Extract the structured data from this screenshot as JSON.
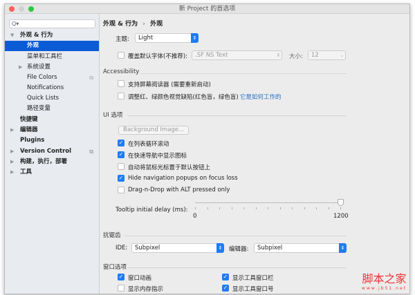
{
  "window": {
    "title": "新 Project 的首选项"
  },
  "sidebar": {
    "search_placeholder": "Q▾",
    "items": [
      {
        "label": "外观 & 行为"
      },
      {
        "label": "外观"
      },
      {
        "label": "菜单和工具栏"
      },
      {
        "label": "系统设置"
      },
      {
        "label": "File Colors"
      },
      {
        "label": "Notifications"
      },
      {
        "label": "Quick Lists"
      },
      {
        "label": "路径变量"
      },
      {
        "label": "快捷键"
      },
      {
        "label": "编辑器"
      },
      {
        "label": "Plugins"
      },
      {
        "label": "Version Control"
      },
      {
        "label": "构建，执行，部署"
      },
      {
        "label": "工具"
      }
    ]
  },
  "breadcrumb": {
    "parent": "外观 & 行为",
    "sep": "›",
    "current": "外观"
  },
  "theme": {
    "label": "主题:",
    "value": "Light"
  },
  "font": {
    "label": "覆盖默认字体(不推荐):",
    "value": ".SF NS Text",
    "size_label": "大小:",
    "size_value": "12",
    "checked": false
  },
  "accessibility": {
    "title": "Accessibility",
    "screen_reader": "支持屏幕阅读器 (需要重新启动)",
    "color_blind": "调整红、绿颜色视觉缺陷(红色盲，绿色盲)",
    "how_link": "它是如何工作的"
  },
  "ui_options": {
    "title": "UI 选项",
    "background_button": "Background Image...",
    "checks": [
      {
        "label": "在列表循环滚动",
        "checked": true
      },
      {
        "label": "在快速导航中显示图标",
        "checked": true
      },
      {
        "label": "自动将鼠标光标置于默认按钮上",
        "checked": false
      },
      {
        "label": "Hide navigation popups on focus loss",
        "checked": true
      },
      {
        "label": "Drag-n-Drop with ALT pressed only",
        "checked": false
      }
    ],
    "tooltip_label": "Tooltip initial delay (ms):",
    "slider_min": "0",
    "slider_max": "1200",
    "slider_value": 1200
  },
  "antialias": {
    "title": "抗锯齿",
    "ide_label": "IDE:",
    "ide_value": "Subpixel",
    "editor_label": "编辑器:",
    "editor_value": "Subpixel"
  },
  "window_options": {
    "title": "窗口选项",
    "checks": [
      {
        "label": "窗口动画",
        "checked": true
      },
      {
        "label": "显示工具窗口栏",
        "checked": true
      },
      {
        "label": "显示内存指示",
        "checked": false
      },
      {
        "label": "显示工具窗口号",
        "checked": true
      }
    ]
  },
  "watermark": {
    "text": "脚本之家",
    "url": "www.jb51.net"
  }
}
